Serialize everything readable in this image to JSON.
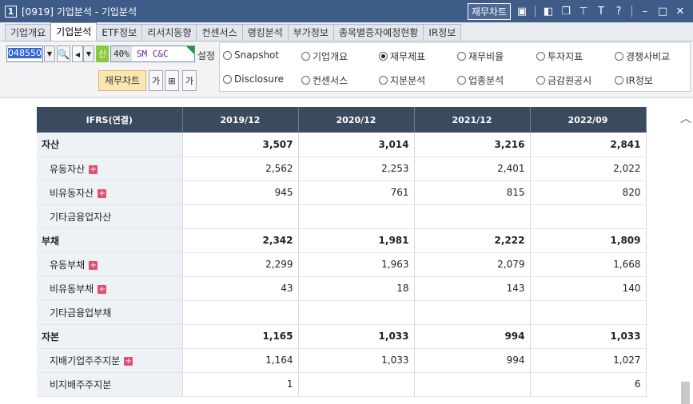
{
  "window": {
    "number": "1",
    "title": "[0919] 기업분석 - 기업분석",
    "fin_chart_label": "재무차트"
  },
  "tabs": [
    {
      "label": "기업개요",
      "active": false
    },
    {
      "label": "기업분석",
      "active": true
    },
    {
      "label": "ETF정보",
      "active": false
    },
    {
      "label": "리서치동향",
      "active": false
    },
    {
      "label": "컨센서스",
      "active": false
    },
    {
      "label": "랭킹분석",
      "active": false
    },
    {
      "label": "부가정보",
      "active": false
    },
    {
      "label": "종목별증자예정현황",
      "active": false
    },
    {
      "label": "IR정보",
      "active": false
    }
  ],
  "toolbar": {
    "code": "048550",
    "new_label": "신",
    "percent": "40%",
    "stock_name": "SM C&C",
    "setting_label": "설정",
    "fin_chart_label": "재무차트",
    "font_down": "가",
    "font_up": "가"
  },
  "radios": [
    {
      "label": "Snapshot",
      "checked": false
    },
    {
      "label": "기업개요",
      "checked": false
    },
    {
      "label": "재무제표",
      "checked": true
    },
    {
      "label": "재무비율",
      "checked": false
    },
    {
      "label": "투자지표",
      "checked": false
    },
    {
      "label": "경쟁사비교",
      "checked": false
    },
    {
      "label": "Disclosure",
      "checked": false
    },
    {
      "label": "컨센서스",
      "checked": false
    },
    {
      "label": "지분분석",
      "checked": false
    },
    {
      "label": "업종분석",
      "checked": false
    },
    {
      "label": "금감원공시",
      "checked": false
    },
    {
      "label": "IR정보",
      "checked": false
    }
  ],
  "table": {
    "headers": [
      "IFRS(연결)",
      "2019/12",
      "2020/12",
      "2021/12",
      "2022/09"
    ],
    "rows": [
      {
        "label": "자산",
        "bold": true,
        "sub": false,
        "plus": false,
        "values": [
          "3,507",
          "3,014",
          "3,216",
          "2,841"
        ]
      },
      {
        "label": "유동자산",
        "bold": false,
        "sub": true,
        "plus": true,
        "values": [
          "2,562",
          "2,253",
          "2,401",
          "2,022"
        ]
      },
      {
        "label": "비유동자산",
        "bold": false,
        "sub": true,
        "plus": true,
        "values": [
          "945",
          "761",
          "815",
          "820"
        ]
      },
      {
        "label": "기타금융업자산",
        "bold": false,
        "sub": true,
        "plus": false,
        "values": [
          "",
          "",
          "",
          ""
        ]
      },
      {
        "label": "부채",
        "bold": true,
        "sub": false,
        "plus": false,
        "values": [
          "2,342",
          "1,981",
          "2,222",
          "1,809"
        ]
      },
      {
        "label": "유동부채",
        "bold": false,
        "sub": true,
        "plus": true,
        "values": [
          "2,299",
          "1,963",
          "2,079",
          "1,668"
        ]
      },
      {
        "label": "비유동부채",
        "bold": false,
        "sub": true,
        "plus": true,
        "values": [
          "43",
          "18",
          "143",
          "140"
        ]
      },
      {
        "label": "기타금융업부채",
        "bold": false,
        "sub": true,
        "plus": false,
        "values": [
          "",
          "",
          "",
          ""
        ]
      },
      {
        "label": "자본",
        "bold": true,
        "sub": false,
        "plus": false,
        "values": [
          "1,165",
          "1,033",
          "994",
          "1,033"
        ]
      },
      {
        "label": "지배기업주주지분",
        "bold": false,
        "sub": true,
        "plus": true,
        "values": [
          "1,164",
          "1,033",
          "994",
          "1,027"
        ]
      },
      {
        "label": "비지배주주지분",
        "bold": false,
        "sub": true,
        "plus": false,
        "values": [
          "1",
          "",
          "",
          "6"
        ]
      }
    ]
  }
}
